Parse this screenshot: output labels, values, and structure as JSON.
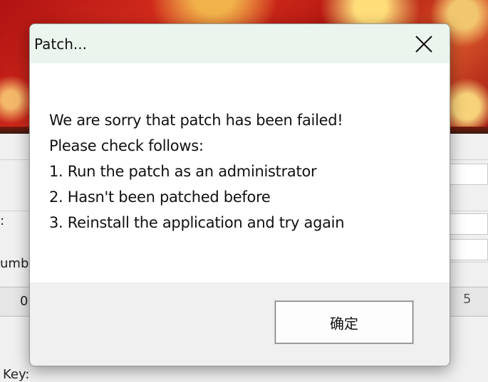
{
  "background": {
    "label_number": "umb",
    "label_colon": ":",
    "cell_value": "0",
    "cell_value_right": "5",
    "label_key": "Key:"
  },
  "dialog": {
    "title": "Patch...",
    "message_lines": [
      "We are sorry that patch has been failed!",
      "Please check follows:",
      "1. Run the patch as an administrator",
      "2. Hasn't been patched before",
      "3. Reinstall the application and try again"
    ],
    "ok_label": "确定"
  },
  "icons": {
    "close": "close-icon"
  },
  "colors": {
    "titlebar": "#ecf4ee",
    "footer": "#f0f0f0",
    "banner_red": "#c8201a"
  }
}
